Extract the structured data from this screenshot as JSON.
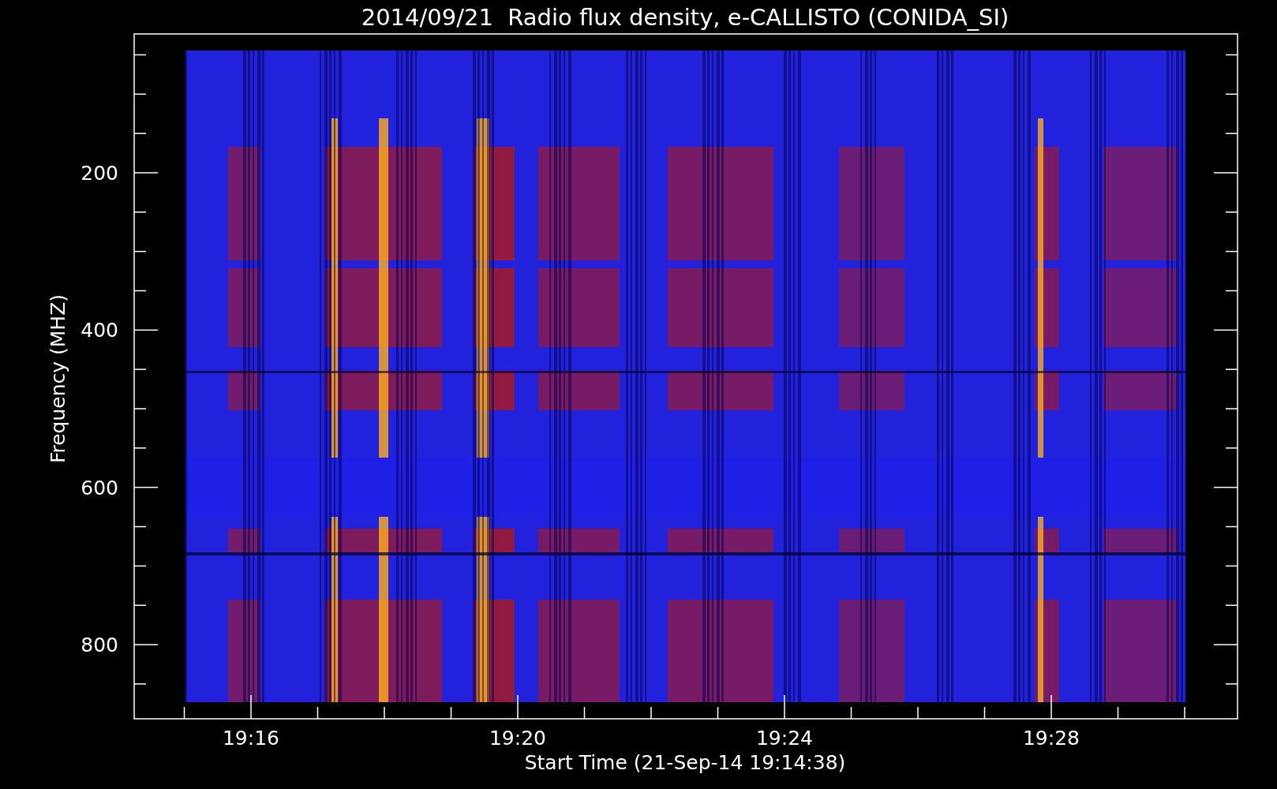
{
  "title": "2014/09/21  Radio flux density, e-CALLISTO (CONIDA_SI)",
  "y_axis": {
    "label": "Frequency (MHZ)",
    "ticks": [
      "200",
      "400",
      "600",
      "800"
    ]
  },
  "x_axis": {
    "label": "Start Time (21-Sep-14 19:14:38)",
    "ticks": [
      "19:16",
      "19:20",
      "19:24",
      "19:28"
    ]
  }
}
